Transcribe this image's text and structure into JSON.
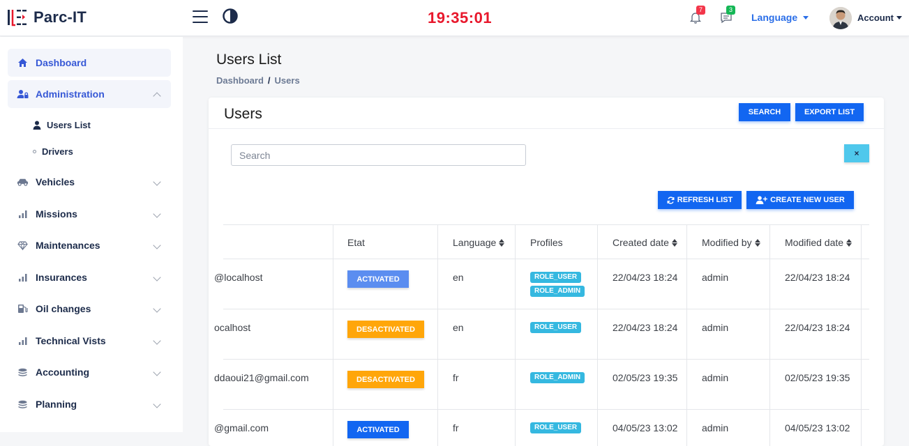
{
  "header": {
    "app_name": "Parc-IT",
    "clock": "19:35:01",
    "notifications_count": "7",
    "messages_count": "3",
    "language_label": "Language",
    "account_label": "Account"
  },
  "sidebar": {
    "items": [
      {
        "label": "Dashboard",
        "icon": "home-icon"
      },
      {
        "label": "Administration",
        "icon": "user-lock-icon"
      },
      {
        "label": "Vehicles",
        "icon": "car-icon"
      },
      {
        "label": "Missions",
        "icon": "bar-chart-icon"
      },
      {
        "label": "Maintenances",
        "icon": "diamond-icon"
      },
      {
        "label": "Insurances",
        "icon": "bar-chart-icon"
      },
      {
        "label": "Oil changes",
        "icon": "fuel-icon"
      },
      {
        "label": "Technical Vists",
        "icon": "bar-chart-icon"
      },
      {
        "label": "Accounting",
        "icon": "coins-icon"
      },
      {
        "label": "Planning",
        "icon": "coins-icon"
      }
    ],
    "sub_items": [
      {
        "label": "Users List"
      },
      {
        "label": "Drivers"
      }
    ]
  },
  "page": {
    "title": "Users List",
    "breadcrumb": [
      "Dashboard",
      "Users"
    ]
  },
  "card": {
    "title": "Users",
    "search_button": "SEARCH",
    "export_button": "EXPORT LIST",
    "search_placeholder": "Search",
    "clear_button": "×",
    "refresh_button": "REFRESH LIST",
    "create_button": "CREATE NEW USER"
  },
  "table": {
    "columns": [
      "Etat",
      "Language",
      "Profiles",
      "Created date",
      "Modified by",
      "Modified date"
    ],
    "rows": [
      {
        "email": "@localhost",
        "etat": "ACTIVATED",
        "language": "en",
        "profiles": [
          "ROLE_USER",
          "ROLE_ADMIN"
        ],
        "created": "22/04/23 18:24",
        "modified_by": "admin",
        "modified": "22/04/23 18:24"
      },
      {
        "email": "ocalhost",
        "etat": "DESACTIVATED",
        "language": "en",
        "profiles": [
          "ROLE_USER"
        ],
        "created": "22/04/23 18:24",
        "modified_by": "admin",
        "modified": "22/04/23 18:24"
      },
      {
        "email": "ddaoui21@gmail.com",
        "etat": "DESACTIVATED",
        "language": "fr",
        "profiles": [
          "ROLE_ADMIN"
        ],
        "created": "02/05/23 19:35",
        "modified_by": "admin",
        "modified": "02/05/23 19:35"
      },
      {
        "email": "@gmail.com",
        "etat": "ACTIVATED",
        "language": "fr",
        "profiles": [
          "ROLE_USER"
        ],
        "created": "04/05/23 13:02",
        "modified_by": "admin",
        "modified": "04/05/23 13:02"
      }
    ]
  },
  "colors": {
    "accent": "#1266f1",
    "clock": "#e8182c",
    "activated": "#5b8df0",
    "desactivated": "#ffa60a",
    "role_badge": "#35b8e0"
  }
}
